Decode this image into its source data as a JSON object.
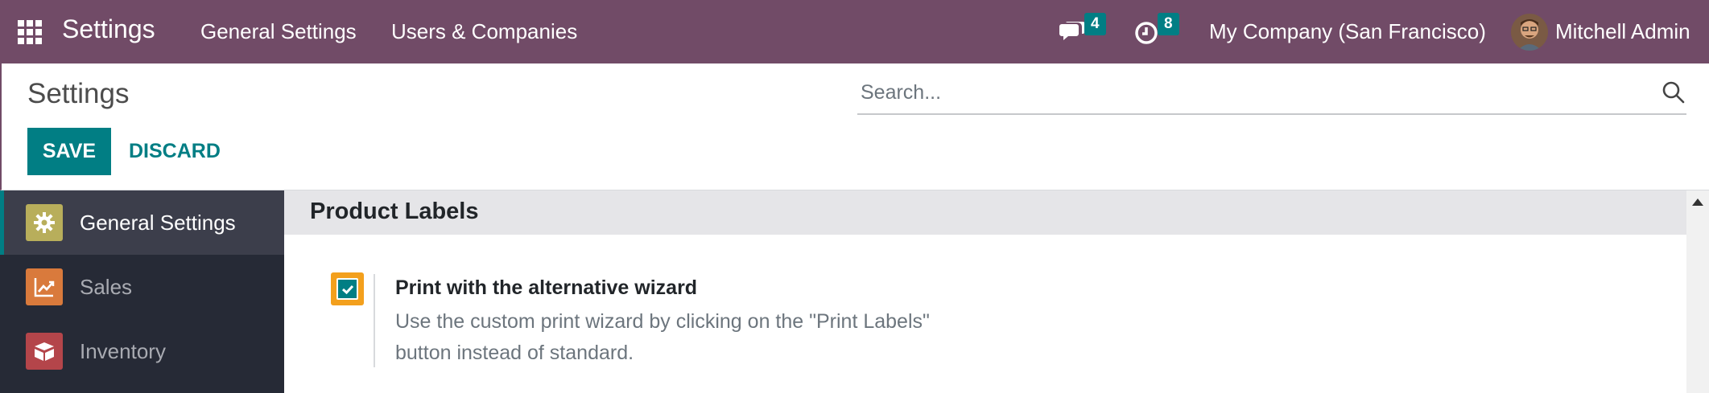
{
  "navbar": {
    "app_title": "Settings",
    "menu": [
      "General Settings",
      "Users & Companies"
    ],
    "messages_count": "4",
    "activities_count": "8",
    "company": "My Company (San Francisco)",
    "user": "Mitchell Admin"
  },
  "control_panel": {
    "title": "Settings",
    "save_label": "SAVE",
    "discard_label": "DISCARD",
    "search_placeholder": "Search..."
  },
  "sidebar": {
    "items": [
      {
        "label": "General Settings",
        "icon": "gear-icon",
        "active": true
      },
      {
        "label": "Sales",
        "icon": "chart-icon",
        "active": false
      },
      {
        "label": "Inventory",
        "icon": "box-icon",
        "active": false
      }
    ]
  },
  "main": {
    "section_title": "Product Labels",
    "setting": {
      "title": "Print with the alternative wizard",
      "description": "Use the custom print wizard by clicking on the \"Print Labels\" button instead of standard.",
      "checked": true
    }
  },
  "colors": {
    "navbar": "#714b67",
    "accent": "#017e84",
    "sidebar": "#262a36",
    "checkbox_focus": "#f3a01d"
  }
}
